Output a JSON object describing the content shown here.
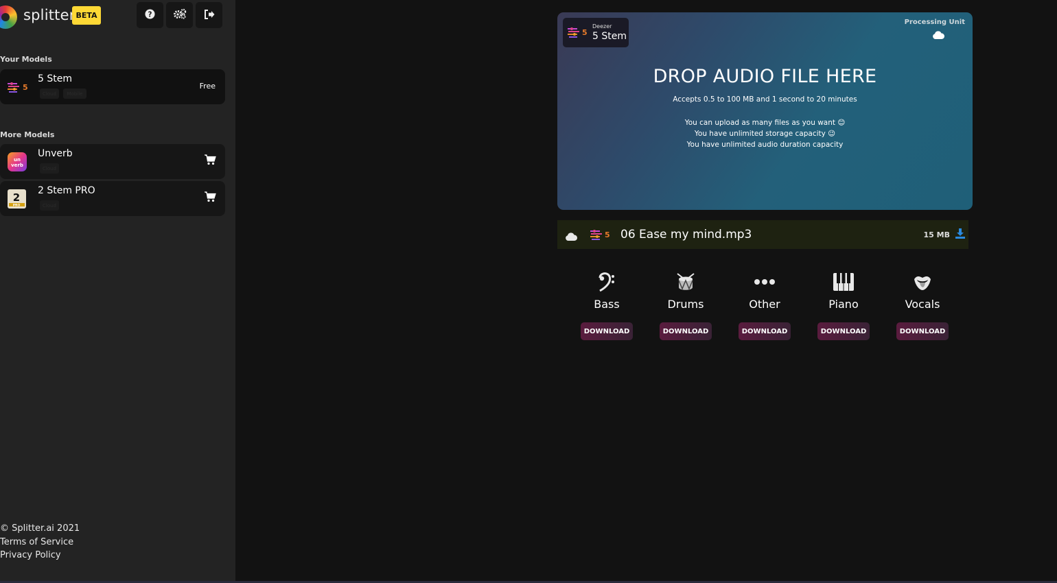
{
  "brand": {
    "name": "splitter",
    "badge": "BETA"
  },
  "toolbar": {
    "help_icon": "question-icon",
    "settings_icon": "gears-icon",
    "logout_icon": "logout-icon"
  },
  "sidebar": {
    "your_models_label": "Your Models",
    "your_models": [
      {
        "name": "5 Stem",
        "tags": [
          "Cloud",
          "Mobile"
        ],
        "price": "Free"
      }
    ],
    "more_models_label": "More Models",
    "more_models": [
      {
        "name": "Unverb",
        "thumb_text": "un verb",
        "tags": [
          "Cloud"
        ],
        "action_icon": "cart-icon"
      },
      {
        "name": "2 Stem PRO",
        "thumb_text": "2",
        "thumb_sub": "PRO",
        "tags": [
          "Cloud"
        ],
        "action_icon": "cart-icon"
      }
    ],
    "footer": {
      "copyright": "© Splitter.ai 2021",
      "terms": "Terms of Service",
      "privacy": "Privacy Policy"
    }
  },
  "dropzone": {
    "engine_small": "Deezer",
    "engine_model": "5 Stem",
    "processing_label": "Processing Unit",
    "title": "DROP AUDIO FILE HERE",
    "accepts": "Accepts 0.5 to 100 MB and 1 second to 20 minutes",
    "line1": "You can upload as many files as you want 😊",
    "line2": "You have unlimited storage capacity 😉",
    "line3": "You have unlimited audio duration capacity"
  },
  "file": {
    "name": "06 Ease my mind.mp3",
    "size": "15 MB"
  },
  "stems": [
    {
      "label": "Bass",
      "icon": "bass-clef-icon",
      "button": "DOWNLOAD"
    },
    {
      "label": "Drums",
      "icon": "drum-icon",
      "button": "DOWNLOAD"
    },
    {
      "label": "Other",
      "icon": "ellipsis-icon",
      "button": "DOWNLOAD"
    },
    {
      "label": "Piano",
      "icon": "piano-keys-icon",
      "button": "DOWNLOAD"
    },
    {
      "label": "Vocals",
      "icon": "mouth-icon",
      "button": "DOWNLOAD"
    }
  ],
  "colors": {
    "accent_yellow": "#fdd835",
    "download_blue": "#2a8ae0",
    "button_maroon": "#5a1c3e"
  }
}
